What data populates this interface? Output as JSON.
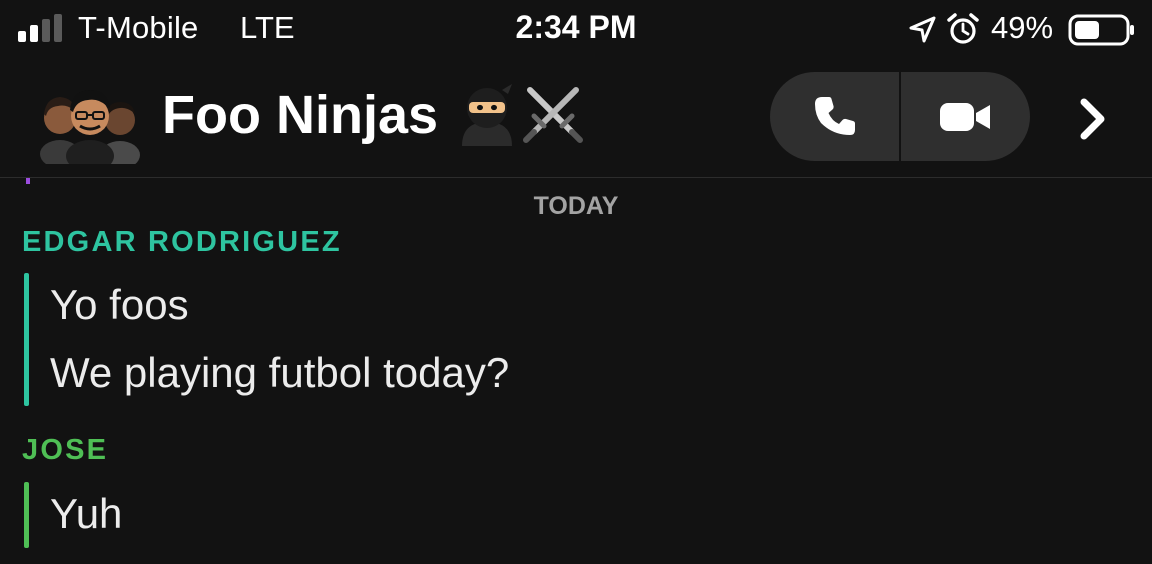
{
  "status_bar": {
    "carrier": "T-Mobile",
    "network": "LTE",
    "time": "2:34 PM",
    "battery_percent": "49%",
    "battery_level": 0.49,
    "icons": [
      "signal-bars-icon",
      "location-arrow-icon",
      "alarm-clock-icon",
      "battery-icon"
    ]
  },
  "header": {
    "group_name": "Foo Ninjas",
    "emojis": [
      "ninja-emoji",
      "crossed-swords-emoji"
    ],
    "avatar": "group-bitmoji-avatar",
    "buttons": [
      "phone-icon",
      "video-camera-icon",
      "chevron-right-icon"
    ]
  },
  "chat": {
    "date_separator": "TODAY",
    "messages": [
      {
        "sender": "EDGAR RODRIGUEZ",
        "color": "#2ec4a0",
        "lines": [
          "Yo foos",
          "We playing futbol today?"
        ]
      },
      {
        "sender": "JOSE",
        "color": "#4fbf55",
        "lines": [
          "Yuh"
        ]
      }
    ]
  },
  "colors": {
    "background": "#121212",
    "edgar": "#2ec4a0",
    "jose": "#4fbf55",
    "button_bg": "#2f2f2f",
    "muted_text": "#a3a3a3"
  }
}
